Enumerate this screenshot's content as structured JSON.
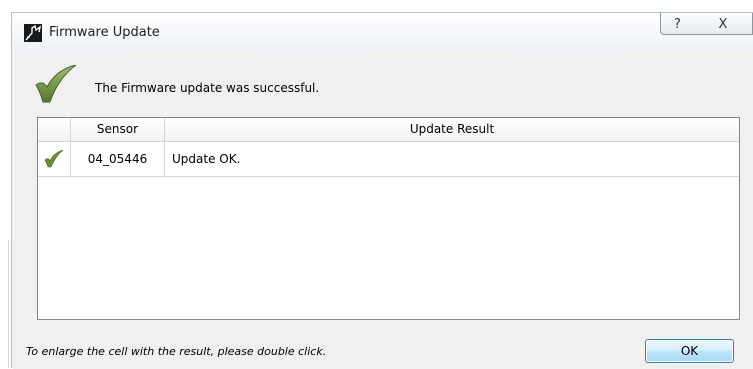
{
  "window": {
    "title": "Firmware Update",
    "help_glyph": "?",
    "close_glyph": "X"
  },
  "message": "The Firmware update was successful.",
  "table": {
    "columns": [
      "Sensor",
      "Update Result"
    ],
    "rows": [
      {
        "status_icon": "check-icon",
        "sensor": "04_05446",
        "result": "Update OK."
      }
    ]
  },
  "hint": "To enlarge the cell with the result, please double click.",
  "ok_label": "OK",
  "colors": {
    "check_green": "#6b8e3a",
    "ok_border": "#3c7fb1"
  }
}
